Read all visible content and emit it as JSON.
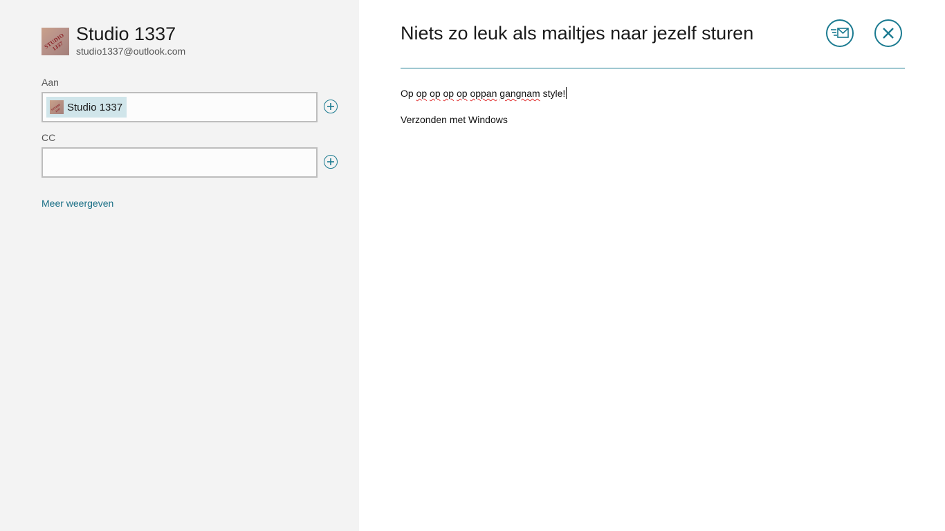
{
  "account": {
    "name": "Studio 1337",
    "email": "studio1337@outlook.com",
    "avatar_text": "STUDIO 1337"
  },
  "to": {
    "label": "Aan",
    "recipients": [
      {
        "name": "Studio 1337"
      }
    ]
  },
  "cc": {
    "label": "CC",
    "value": ""
  },
  "more_link": "Meer weergeven",
  "message": {
    "subject": "Niets zo leuk als mailtjes naar jezelf sturen",
    "body": {
      "word_op": "Op",
      "words_misspelled": [
        "op",
        "op",
        "op",
        "op",
        "oppan",
        "gangnam"
      ],
      "word_style": "style!",
      "signature": "Verzonden met Windows"
    }
  },
  "icons": {
    "send": "send-mail-icon",
    "close": "close-icon",
    "add": "plus-circle-icon"
  },
  "colors": {
    "accent": "#1a7a90",
    "left_pane_bg": "#f3f3f3",
    "chip_bg": "#d0e5ea",
    "link": "#1a6f86"
  }
}
